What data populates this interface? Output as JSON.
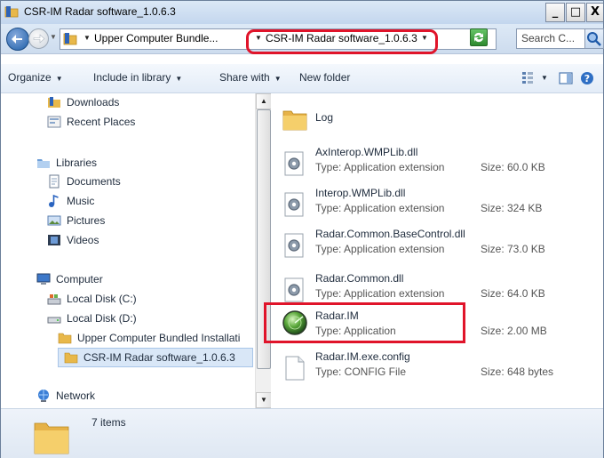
{
  "window": {
    "title": "CSR-IM Radar software_1.0.6.3",
    "buttons": {
      "minimize": "_",
      "maximize": "□",
      "close": "X"
    }
  },
  "address_bar": {
    "crumbs": [
      "Upper Computer Bundle...",
      "CSR-IM Radar software_1.0.6.3"
    ],
    "search_placeholder": "Search C..."
  },
  "toolbar": {
    "organize": "Organize",
    "include_in_library": "Include in library",
    "share_with": "Share with",
    "new_folder": "New folder"
  },
  "nav_pane": {
    "items": [
      {
        "label": "Downloads",
        "icon": "downloads-icon"
      },
      {
        "label": "Recent Places",
        "icon": "recent-places-icon"
      },
      {
        "label": "Libraries",
        "icon": "libraries-icon"
      },
      {
        "label": "Documents",
        "icon": "documents-icon"
      },
      {
        "label": "Music",
        "icon": "music-icon"
      },
      {
        "label": "Pictures",
        "icon": "pictures-icon"
      },
      {
        "label": "Videos",
        "icon": "videos-icon"
      },
      {
        "label": "Computer",
        "icon": "computer-icon"
      },
      {
        "label": "Local Disk (C:)",
        "icon": "local-disk-icon"
      },
      {
        "label": "Local Disk (D:)",
        "icon": "local-disk-icon"
      },
      {
        "label": "Upper Computer Bundled Installati",
        "icon": "folder-icon"
      },
      {
        "label": "CSR-IM Radar software_1.0.6.3",
        "icon": "folder-icon"
      },
      {
        "label": "Network",
        "icon": "network-icon"
      }
    ]
  },
  "files": [
    {
      "name": "Log",
      "type": "",
      "size": "",
      "icon": "folder-icon"
    },
    {
      "name": "AxInterop.WMPLib.dll",
      "type": "Type: Application extension",
      "size": "Size: 60.0 KB",
      "icon": "dll-gear-icon"
    },
    {
      "name": "Interop.WMPLib.dll",
      "type": "Type: Application extension",
      "size": "Size: 324 KB",
      "icon": "dll-gear-icon"
    },
    {
      "name": "Radar.Common.BaseControl.dll",
      "type": "Type: Application extension",
      "size": "Size: 73.0 KB",
      "icon": "dll-gear-icon"
    },
    {
      "name": "Radar.Common.dll",
      "type": "Type: Application extension",
      "size": "Size: 64.0 KB",
      "icon": "dll-gear-icon"
    },
    {
      "name": "Radar.IM",
      "type": "Type: Application",
      "size": "Size: 2.00 MB",
      "icon": "radar-app-icon"
    },
    {
      "name": "Radar.IM.exe.config",
      "type": "Type: CONFIG File",
      "size": "Size: 648 bytes",
      "icon": "config-file-icon"
    }
  ],
  "details": {
    "item_count": "7 items"
  },
  "colors": {
    "highlight": "#e0142a",
    "selection": "#d9e7f7"
  }
}
